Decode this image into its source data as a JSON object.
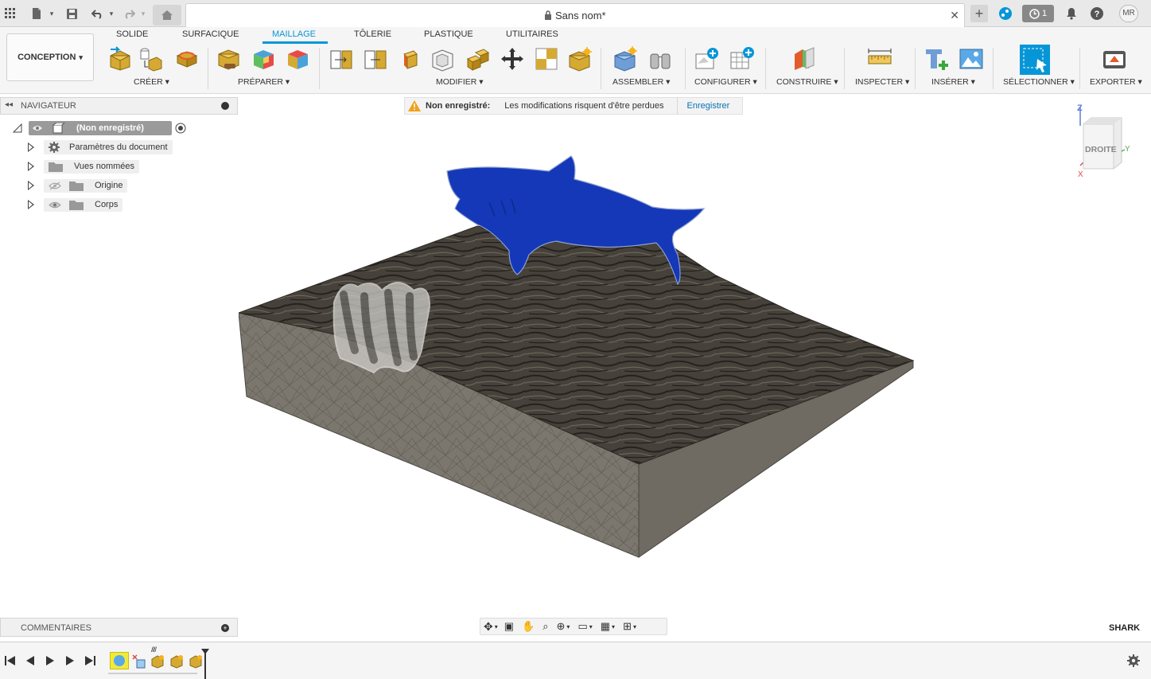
{
  "titlebar": {
    "doc_title": "Sans nom*",
    "close_glyph": "✕",
    "add_tab_glyph": "+",
    "job_count": "1",
    "user_initials": "MR",
    "icons": [
      "apps-grid-icon",
      "file-icon",
      "save-icon",
      "undo-icon",
      "redo-icon",
      "home-icon",
      "lock-icon",
      "extensions-icon",
      "job-status-icon",
      "bell-icon",
      "help-icon"
    ]
  },
  "ribbon": {
    "workspace": "CONCEPTION",
    "tabs": [
      {
        "label": "SOLIDE"
      },
      {
        "label": "SURFACIQUE"
      },
      {
        "label": "MAILLAGE"
      },
      {
        "label": "TÔLERIE"
      },
      {
        "label": "PLASTIQUE"
      },
      {
        "label": "UTILITAIRES"
      }
    ],
    "active_tab": "MAILLAGE",
    "groups": [
      {
        "label": "CRÉER"
      },
      {
        "label": "PRÉPARER"
      },
      {
        "label": "MODIFIER"
      },
      {
        "label": "ASSEMBLER"
      },
      {
        "label": "CONFIGURER"
      },
      {
        "label": "CONSTRUIRE"
      },
      {
        "label": "INSPECTER"
      },
      {
        "label": "INSÉRER"
      },
      {
        "label": "SÉLECTIONNER"
      },
      {
        "label": "EXPORTER"
      }
    ]
  },
  "navigator": {
    "title": "NAVIGATEUR",
    "root": "(Non enregistré)",
    "items": [
      {
        "label": "Paramètres du document"
      },
      {
        "label": "Vues nommées"
      },
      {
        "label": "Origine"
      },
      {
        "label": "Corps"
      }
    ]
  },
  "warning": {
    "title": "Non enregistré:",
    "message": "Les modifications risquent d'être perdues",
    "action": "Enregistrer"
  },
  "viewcube": {
    "face": "DROITE",
    "axis_z": "Z",
    "axis_y": "Y",
    "axis_x": "X"
  },
  "comments": {
    "title": "COMMENTAIRES"
  },
  "status": {
    "brand": "SHARK"
  },
  "colors": {
    "accent": "#0696d7",
    "shark": "#1438b8",
    "terrain": "#3f3a33",
    "mesh_side": "#7a756c"
  }
}
